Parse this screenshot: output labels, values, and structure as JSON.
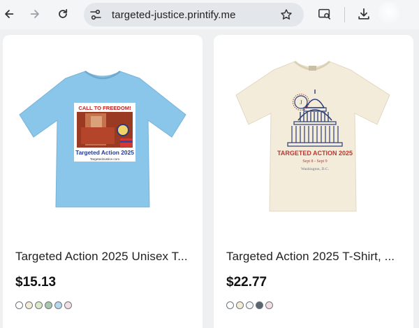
{
  "browser": {
    "url": "targeted-justice.printify.me",
    "icons": [
      "back-arrow-icon",
      "forward-arrow-icon",
      "reload-icon",
      "site-info-icon",
      "bookmark-star-icon",
      "cast-search-icon",
      "download-icon",
      "profile-avatar-icon"
    ]
  },
  "products": [
    {
      "title": "Targeted Action 2025 Unisex T...",
      "price": "$15.13",
      "shirt_color": "#89c6ea",
      "print": {
        "banner": "CALL TO FREEDOM!",
        "caption": "Targeted Action 2025",
        "site": "TargetedJustice.com"
      },
      "swatches": [
        "#ffffff",
        "#f3ecd7",
        "#dce9c8",
        "#a7c8ad",
        "#b6d8ef",
        "#f3dfe3"
      ]
    },
    {
      "title": "Targeted Action 2025 T-Shirt, ...",
      "price": "$22.77",
      "shirt_color": "#f3ecdb",
      "print": {
        "caption": "TARGETED ACTION 2025",
        "line2": "Sept 8 - Sept 9",
        "line3": "Washington, D.C."
      },
      "swatches": [
        "#ffffff",
        "#f3ecd7",
        "#f7f7f7",
        "#5a6572",
        "#f3dfe3"
      ]
    }
  ]
}
